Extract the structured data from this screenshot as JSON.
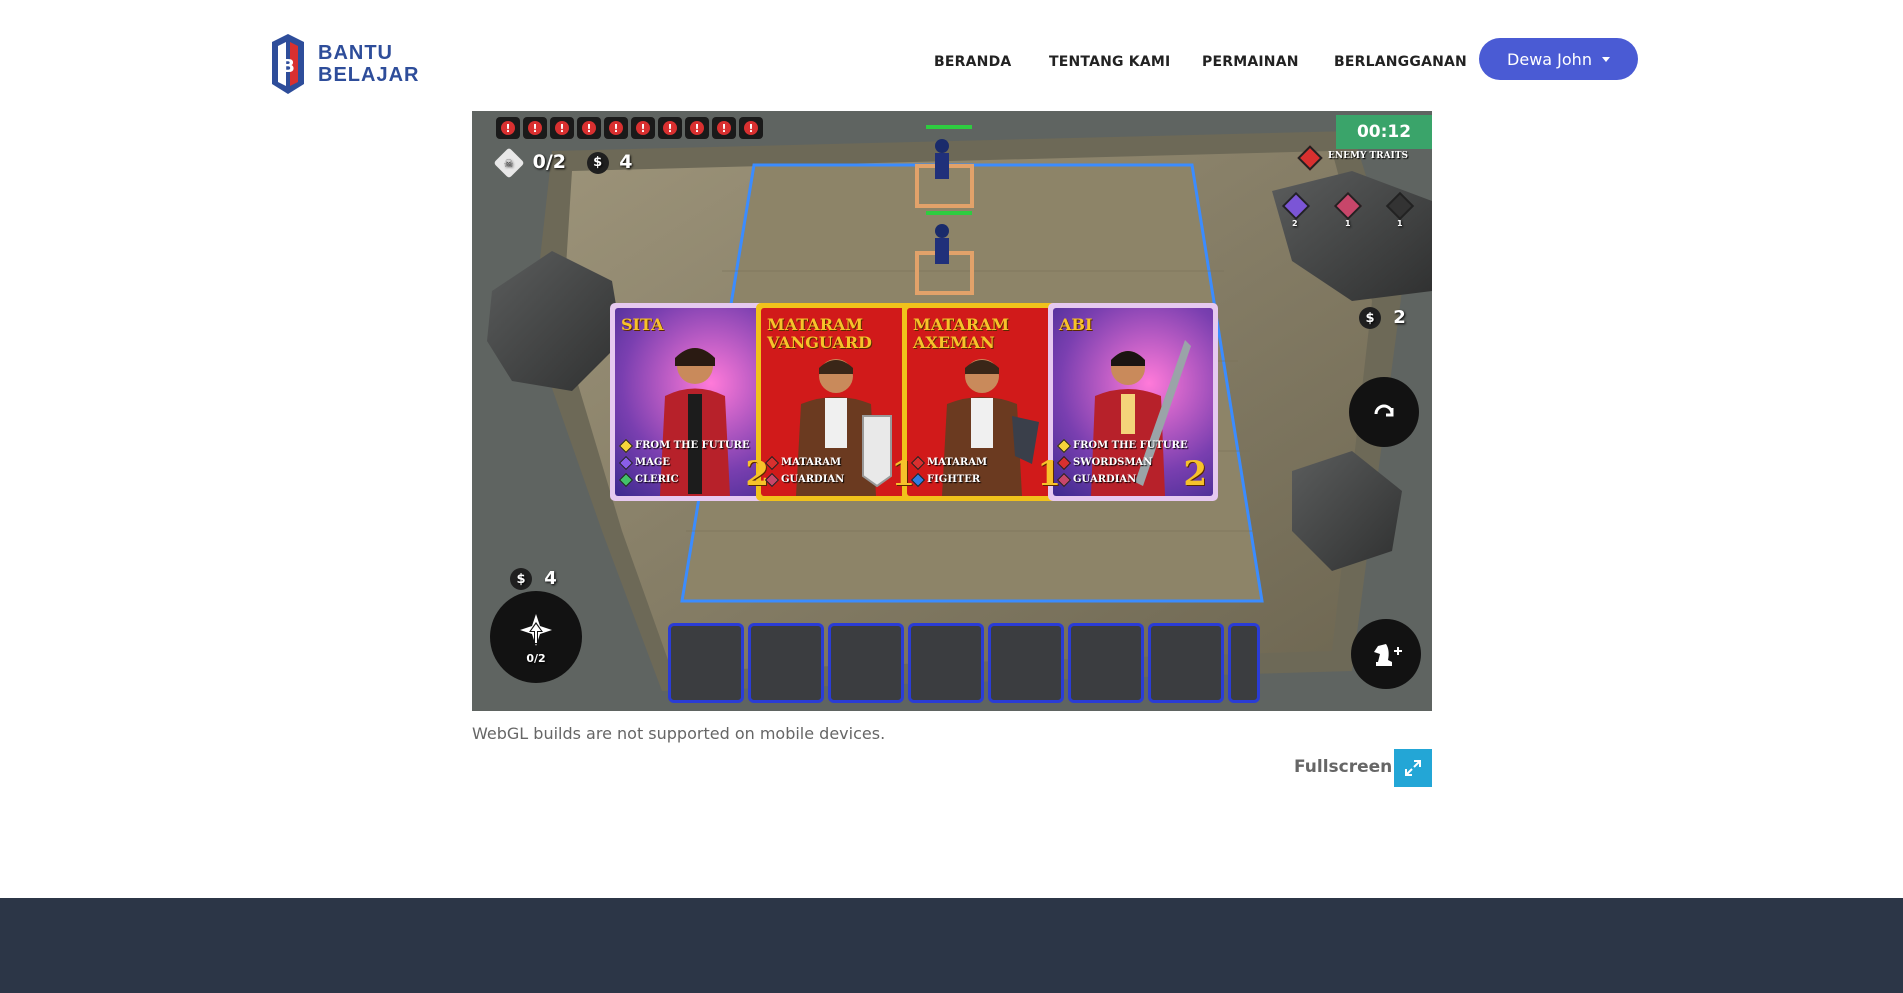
{
  "brand": {
    "logo_line1": "BANTU",
    "logo_line2": "BELAJAR",
    "logo_color": "#2e4d9a",
    "logo_accent": "#d9302f"
  },
  "nav": {
    "items": [
      {
        "label": "BERANDA"
      },
      {
        "label": "TENTANG KAMI"
      },
      {
        "label": "PERMAINAN"
      },
      {
        "label": "BERLANGGANAN"
      }
    ],
    "user_name": "Dewa John",
    "user_button_color": "#4a5bd4"
  },
  "game": {
    "alerts": [
      "!",
      "!",
      "!",
      "!",
      "!",
      "!",
      "!",
      "!",
      "!",
      "!"
    ],
    "units_count": "0/2",
    "gold": "4",
    "timer": "00:12",
    "enemy_traits_label": "ENEMY TRAITS",
    "enemy_trait_counts": [
      "2",
      "1",
      "1"
    ],
    "reroll_cost": "2",
    "level_cost": "4",
    "level_progress": "0/2",
    "cards": [
      {
        "name": "SITA",
        "cost": "2",
        "traits": [
          "FROM THE FUTURE",
          "MAGE",
          "CLERIC"
        ],
        "frame": "#e6c9f0",
        "bg": "#7a3fb0"
      },
      {
        "name": "MATARAM VANGUARD",
        "cost": "1",
        "traits": [
          "MATARAM",
          "GUARDIAN"
        ],
        "frame": "#f1c21b",
        "bg": "#d11a1a"
      },
      {
        "name": "MATARAM AXEMAN",
        "cost": "1",
        "traits": [
          "MATARAM",
          "FIGHTER"
        ],
        "frame": "#f1c21b",
        "bg": "#d11a1a"
      },
      {
        "name": "ABI",
        "cost": "2",
        "traits": [
          "FROM THE FUTURE",
          "SWORDSMAN",
          "GUARDIAN"
        ],
        "frame": "#e6c9f0",
        "bg": "#7a3fb0"
      }
    ],
    "bench_slots": 8,
    "timer_color": "#3aa46a"
  },
  "notice": "WebGL builds are not supported on mobile devices.",
  "fullscreen": {
    "label": "Fullscreen",
    "icon": "expand-icon",
    "color": "#23a6d6"
  },
  "footer_color": "#2c3647"
}
